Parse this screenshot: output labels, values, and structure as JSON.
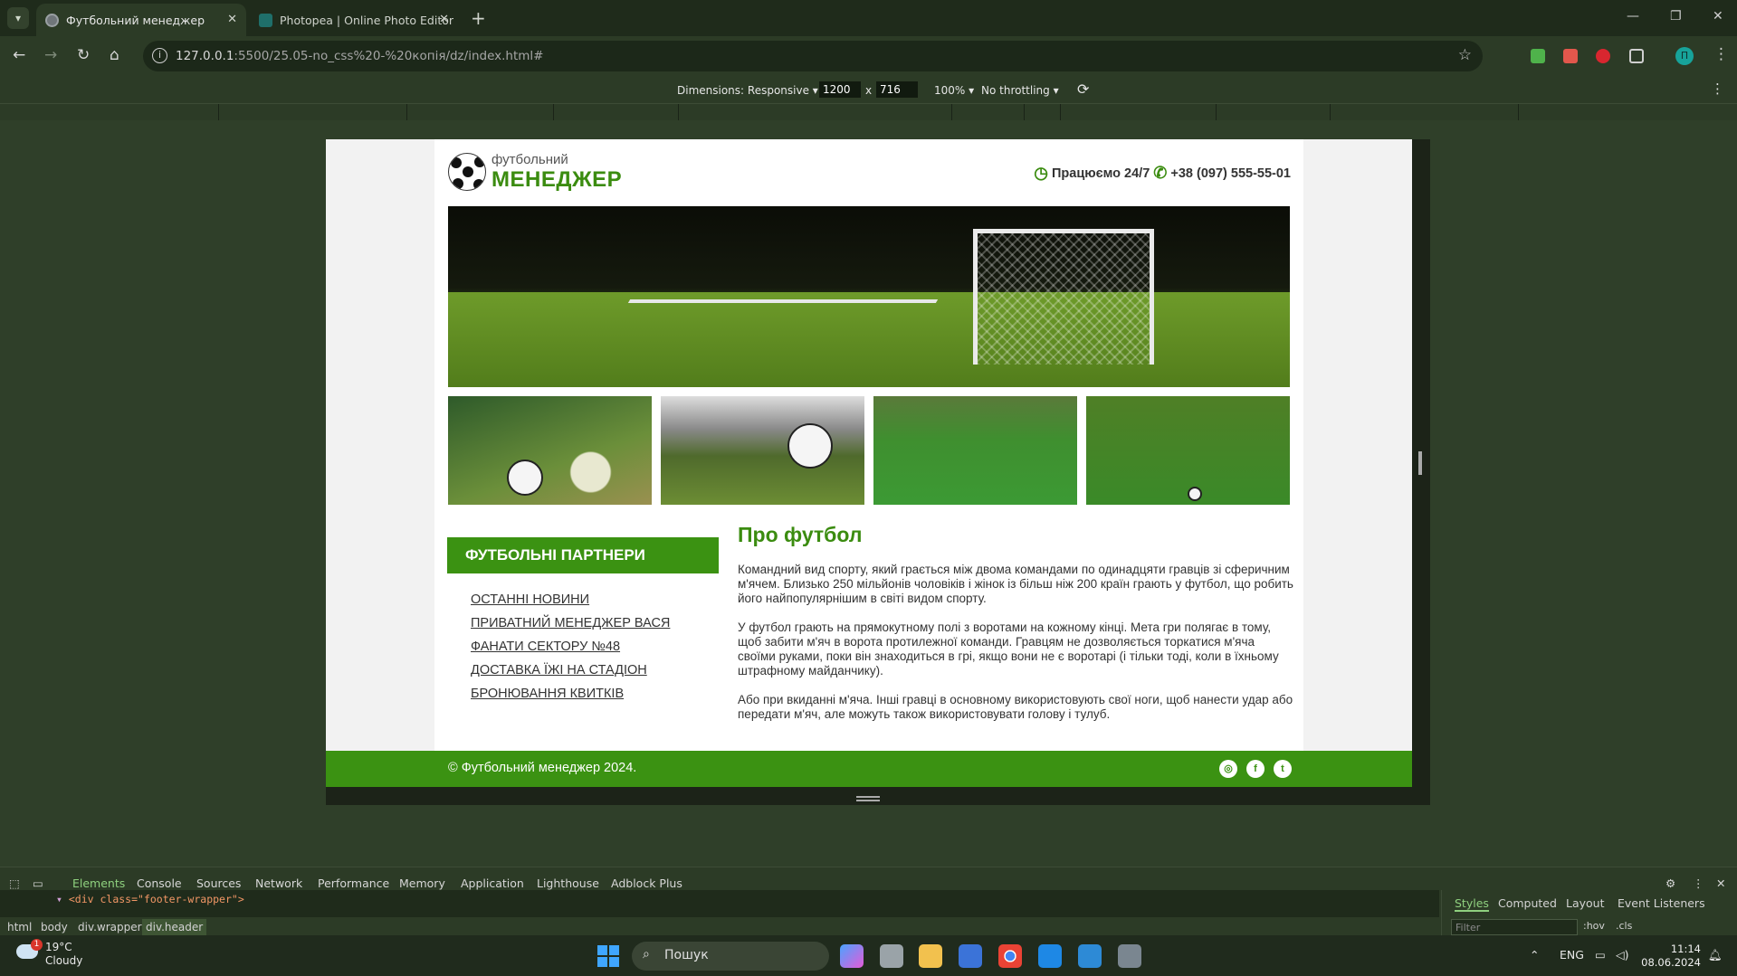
{
  "browser": {
    "tabs": [
      {
        "title": "Футбольний менеджер"
      },
      {
        "title": "Photopea | Online Photo Editor"
      }
    ],
    "url_host": "127.0.0.1",
    "url_rest": ":5500/25.05-no_css%20-%20копія/dz/index.html#",
    "profile_letter": "П"
  },
  "device_toolbar": {
    "dimensions_label": "Dimensions: Responsive",
    "width": "1200",
    "x": "x",
    "height": "716",
    "zoom": "100%",
    "throttling": "No throttling"
  },
  "site": {
    "logo_small": "футбольний",
    "logo_big": "МЕНЕДЖЕР",
    "hours": "Працюємо 24/7",
    "phone": "+38 (097) 555-55-01",
    "sidebar_title": "ФУТБОЛЬНІ ПАРТНЕРИ",
    "sidebar_links": [
      "ОСТАННІ НОВИНИ",
      "ПРИВАТНИЙ МЕНЕДЖЕР ВАСЯ",
      "ФАНАТИ СЕКТОРУ №48",
      "ДОСТАВКА ЇЖІ НА СТАДІОН",
      "БРОНЮВАННЯ КВИТКІВ"
    ],
    "content_title": "Про футбол",
    "paragraphs": [
      "Командний вид спорту, який грається між двома командами по одинадцяти гравців зі сферичним м'ячем. Близько 250 мільйонів чоловіків і жінок із більш ніж 200 країн грають у футбол, що робить його найпопулярнішим в світі видом спорту.",
      "У футбол грають на прямокутному полі з воротами на кожному кінці. Мета гри полягає в тому, щоб забити м'яч в ворота протилежної команди. Гравцям не дозволяється торкатися м'яча своїми руками, поки він знаходиться в грі, якщо вони не є воротарі (і тільки тоді, коли в їхньому штрафному майданчику).",
      "Або при вкиданні м'яча. Інші гравці в основному використовують свої ноги, щоб нанести удар або передати м'яч, але можуть також використовувати голову і тулуб."
    ],
    "footer_copy": "© Футбольний менеджер 2024."
  },
  "devtools": {
    "tabs": [
      "Elements",
      "Console",
      "Sources",
      "Network",
      "Performance",
      "Memory",
      "Application",
      "Lighthouse",
      "Adblock Plus"
    ],
    "code_line_tag": "<div class=",
    "code_line_class": "\"footer-wrapper\"",
    "code_line_end": ">",
    "breadcrumbs": [
      "html",
      "body",
      "div.wrapper",
      "div.header"
    ],
    "styles_tabs": [
      "Styles",
      "Computed",
      "Layout",
      "Event Listeners"
    ],
    "filter_placeholder": "Filter",
    "hov": ":hov",
    "cls": ".cls"
  },
  "taskbar": {
    "temp": "19°C",
    "weather": "Cloudy",
    "search": "Пошук",
    "lang": "ENG",
    "time": "11:14",
    "date": "08.06.2024",
    "notif_count": "1"
  },
  "colors": {
    "accent_green": "#3b9212",
    "title_green": "#3b8c10"
  }
}
